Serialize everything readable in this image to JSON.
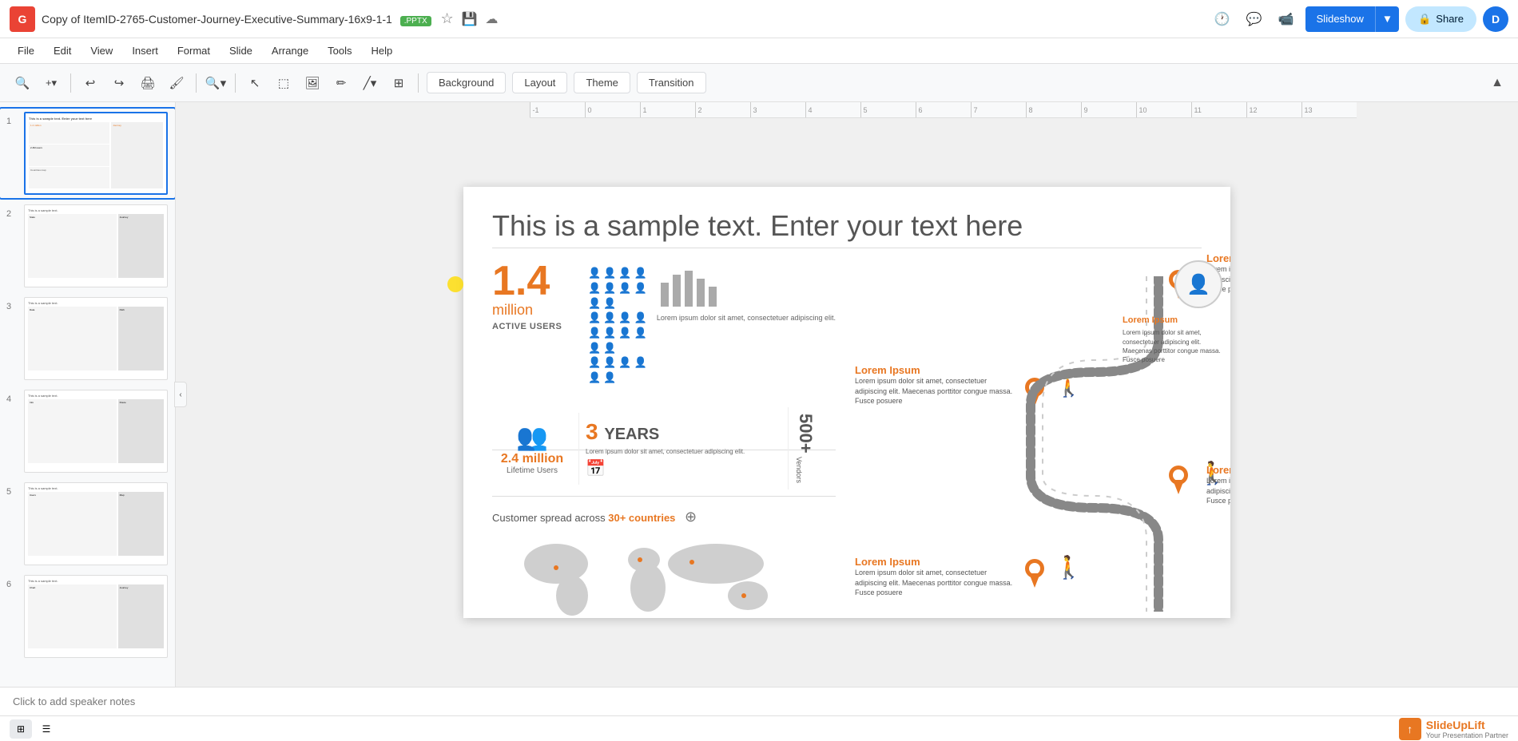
{
  "titlebar": {
    "logo": "G",
    "logo_bg": "#EA4335",
    "doc_title": "Copy of ItemID-2765-Customer-Journey-Executive-Summary-16x9-1-1",
    "file_badge": ".PPTX",
    "slideshow_label": "Slideshow",
    "share_label": "Share",
    "user_initial": "D"
  },
  "menu": {
    "items": [
      "File",
      "Edit",
      "View",
      "Insert",
      "Format",
      "Slide",
      "Arrange",
      "Tools",
      "Help"
    ]
  },
  "toolbar": {
    "background_label": "Background",
    "layout_label": "Layout",
    "theme_label": "Theme",
    "transition_label": "Transition"
  },
  "ruler": {
    "marks": [
      "-1",
      "0",
      "1",
      "2",
      "3",
      "4",
      "5",
      "6",
      "7",
      "8",
      "9",
      "10",
      "11",
      "12",
      "13"
    ]
  },
  "slides": [
    {
      "number": "1",
      "active": true
    },
    {
      "number": "2",
      "active": false
    },
    {
      "number": "3",
      "active": false
    },
    {
      "number": "4",
      "active": false
    },
    {
      "number": "5",
      "active": false
    },
    {
      "number": "6",
      "active": false
    }
  ],
  "slide_content": {
    "title": "This is a sample text. Enter your text here",
    "stat1": {
      "number": "1.4",
      "unit": "million",
      "label": "ACTIVE USERS",
      "description": "Lorem ipsum dolor sit amet, consectetuer adipiscing elit."
    },
    "stat2": {
      "number": "2.4 million",
      "label": "Lifetime Users",
      "years": "3",
      "years_label": "YEARS",
      "vendors": "500+",
      "vendors_label": "Vendors"
    },
    "map": {
      "countries_text": "Customer spread across",
      "countries_highlight": "30+ countries"
    },
    "journey": {
      "items": [
        {
          "title": "Lorem Ipsum",
          "desc": "Lorem ipsum dolor sit amet, consectetuer adipiscing elit. Maecenas porttitor congue massa. Fusce posuere"
        },
        {
          "title": "Lorem Ipsum",
          "desc": "Lorem ipsum dolor sit amet, consectetuer adipiscing elit. Maecenas porttitor congue massa. Fusce posuere"
        },
        {
          "title": "Lorem Ipsum",
          "desc": "Lorem ipsum dolor sit amet, consectetuer adipiscing elit. Maecenas porttitor congue massa. Fusce posuere"
        },
        {
          "title": "Lorem Ipsum",
          "desc": "Lorem ipsum dolor sit amet, consectetuer adipiscing elit. Maecenas porttitor congue massa. Fusce posuere"
        }
      ]
    }
  },
  "notes": {
    "placeholder": "Click to add speaker notes"
  },
  "slideuplift": {
    "name": "SlideUpLift",
    "tagline": "Your Presentation Partner"
  },
  "colors": {
    "orange": "#e87722",
    "blue": "#1a73e8",
    "dark_gray": "#555",
    "light_gray": "#999"
  }
}
